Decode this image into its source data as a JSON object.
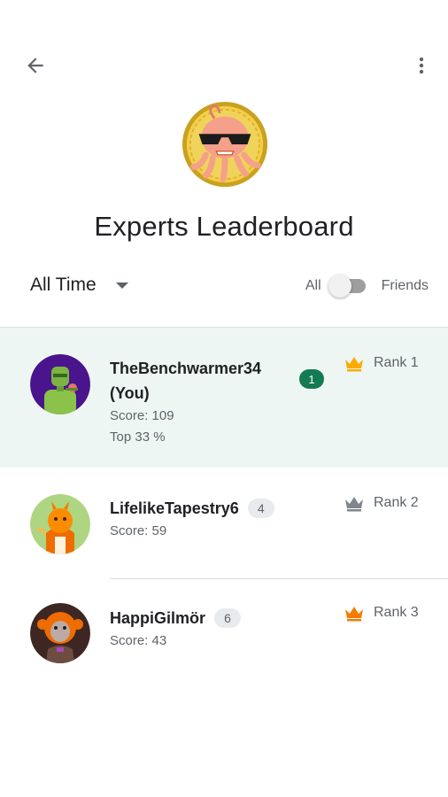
{
  "header": {
    "back_icon": "arrow-back-icon",
    "more_icon": "more-vert-icon"
  },
  "hero": {
    "badge_icon": "octopus-sunglasses-badge",
    "title": "Experts Leaderboard"
  },
  "filters": {
    "period_label": "All Time",
    "toggle_left_label": "All",
    "toggle_right_label": "Friends",
    "toggle_on": false
  },
  "colors": {
    "highlight_row": "#eef6f3",
    "your_level_badge": "#137a52",
    "crown_gold": "#f9ab00",
    "crown_silver": "#80868b",
    "crown_bronze": "#f57c00"
  },
  "leaderboard": [
    {
      "name": "TheBenchwarmer34",
      "you_label": "(You)",
      "level": "1",
      "score": "Score: 109",
      "top": "Top 33 %",
      "rank": "Rank 1",
      "avatar_icon": "robot-avatar",
      "crown_icon": "crown-gold-icon"
    },
    {
      "name": "LifelikeTapestry6",
      "level": "4",
      "score": "Score: 59",
      "rank": "Rank 2",
      "avatar_icon": "dragon-avatar",
      "crown_icon": "crown-silver-icon"
    },
    {
      "name": "HappiGilmör",
      "level": "6",
      "score": "Score: 43",
      "rank": "Rank 3",
      "avatar_icon": "monkey-avatar",
      "crown_icon": "crown-bronze-icon"
    }
  ]
}
